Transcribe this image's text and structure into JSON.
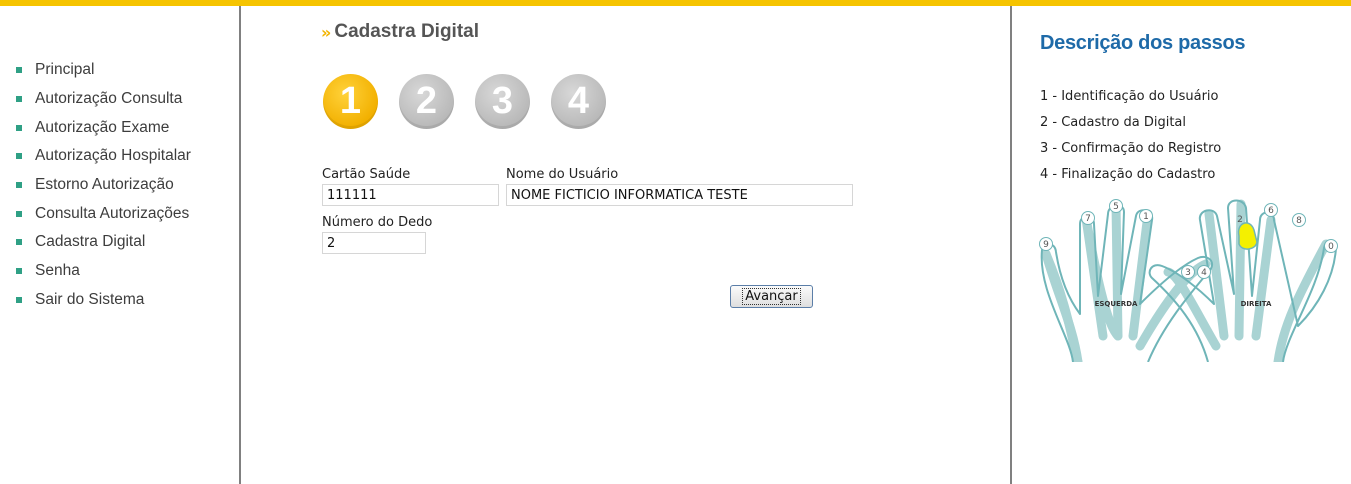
{
  "sidebar": {
    "items": [
      {
        "label": "Principal"
      },
      {
        "label": "Autorização Consulta"
      },
      {
        "label": "Autorização Exame"
      },
      {
        "label": "Autorização Hospitalar"
      },
      {
        "label": "Estorno Autorização"
      },
      {
        "label": "Consulta Autorizações"
      },
      {
        "label": "Cadastra Digital"
      },
      {
        "label": "Senha"
      },
      {
        "label": "Sair do Sistema"
      }
    ]
  },
  "main": {
    "title_arrow": "»",
    "title": "Cadastra Digital",
    "steps": [
      {
        "label": "1",
        "state": "active"
      },
      {
        "label": "2",
        "state": "inactive"
      },
      {
        "label": "3",
        "state": "inactive"
      },
      {
        "label": "4",
        "state": "inactive"
      }
    ],
    "form": {
      "cartao_label": "Cartão Saúde",
      "cartao_value": "111111",
      "nome_label": "Nome do Usuário",
      "nome_value": "NOME FICTICIO INFORMATICA TESTE",
      "dedo_label": "Número do Dedo",
      "dedo_value": "2"
    },
    "advance_button": "Avançar"
  },
  "right_panel": {
    "title": "Descrição dos passos",
    "steps": [
      "1 - Identificação do Usuário",
      "2 - Cadastro da Digital",
      "3 - Confirmação do Registro",
      "4 - Finalização do Cadastro"
    ],
    "hands": {
      "left_label": "ESQUERDA",
      "right_label": "DIREITA",
      "left_fingers": [
        "9",
        "7",
        "5",
        "1",
        "3"
      ],
      "right_fingers": [
        "4",
        "2",
        "6",
        "8",
        "0"
      ],
      "selected_finger": "2"
    }
  },
  "colors": {
    "accent": "#f6c400",
    "nav_bullet": "#2fa085",
    "heading_blue": "#1e6aa8",
    "finger_highlight": "#f4f000"
  }
}
